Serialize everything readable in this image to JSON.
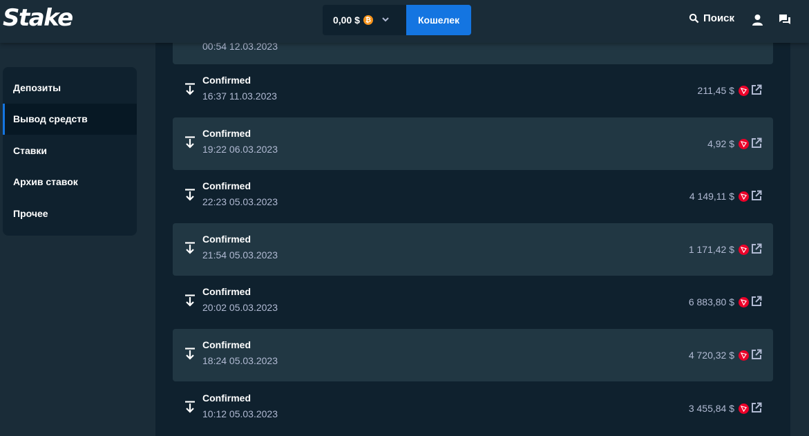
{
  "header": {
    "logo": "Stake",
    "balance": "0,00 $",
    "currency_icon": "bitcoin-icon",
    "wallet_label": "Кошелек",
    "search_label": "Поиск"
  },
  "sidebar": {
    "items": [
      {
        "label": "Депозиты"
      },
      {
        "label": "Вывод средств"
      },
      {
        "label": "Ставки"
      },
      {
        "label": "Архив ставок"
      },
      {
        "label": "Прочее"
      }
    ]
  },
  "transactions": {
    "partial_top_date": "00:54 12.03.2023",
    "rows": [
      {
        "status": "Confirmed",
        "date": "16:37 11.03.2023",
        "amount": "211,45 $"
      },
      {
        "status": "Confirmed",
        "date": "19:22 06.03.2023",
        "amount": "4,92 $"
      },
      {
        "status": "Confirmed",
        "date": "22:23 05.03.2023",
        "amount": "4 149,11 $"
      },
      {
        "status": "Confirmed",
        "date": "21:54 05.03.2023",
        "amount": "1 171,42 $"
      },
      {
        "status": "Confirmed",
        "date": "20:02 05.03.2023",
        "amount": "6 883,80 $"
      },
      {
        "status": "Confirmed",
        "date": "18:24 05.03.2023",
        "amount": "4 720,32 $"
      },
      {
        "status": "Confirmed",
        "date": "10:12 05.03.2023",
        "amount": "3 455,84 $"
      }
    ]
  },
  "colors": {
    "accent": "#1475e1",
    "background": "#1a2c38",
    "panel": "#0f212e",
    "row_alt": "#213743",
    "muted_text": "#b1bad3",
    "tron_red": "#eb0029",
    "bitcoin_orange": "#f7931a"
  }
}
